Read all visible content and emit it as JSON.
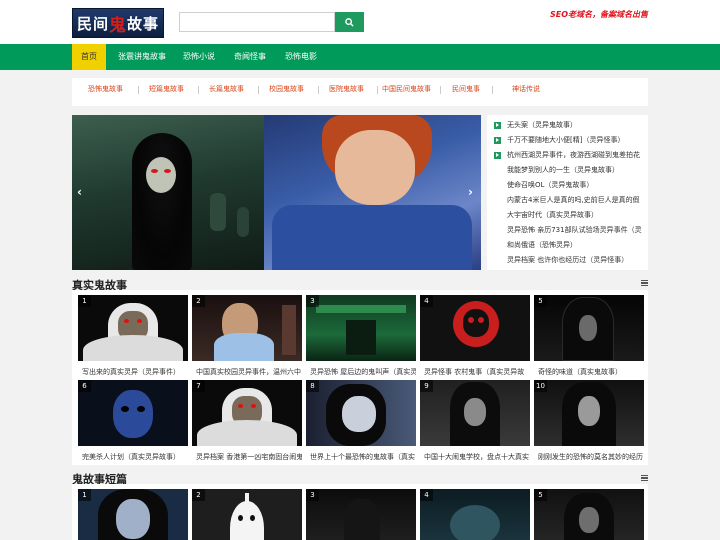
{
  "header": {
    "logo_text_1": "民间",
    "logo_text_2": "鬼",
    "logo_text_3": "故事",
    "search_placeholder": "",
    "slogan": "SEO老域名，备案域名出售"
  },
  "nav": {
    "items": [
      {
        "label": "首页",
        "active": true
      },
      {
        "label": "张震讲鬼故事"
      },
      {
        "label": "恐怖小说"
      },
      {
        "label": "奇闻怪事"
      },
      {
        "label": "恐怖电影"
      }
    ]
  },
  "categories": [
    "恐怖鬼故事",
    "短篇鬼故事",
    "长篇鬼故事",
    "校园鬼故事",
    "医院鬼故事",
    "中国民间鬼故事",
    "民间鬼事",
    "神话传说"
  ],
  "slider": {
    "prev": "‹",
    "next": "›"
  },
  "side_list": [
    "无头案（灵异鬼故事）",
    "千万不要随地大小便[精]（灵异怪事）",
    "杭州西湖灵异事件，夜游西湖碰到鬼差拍花",
    "我能梦到别人的一生（灵异鬼故事）",
    "使命召唤OL（灵异鬼故事）",
    "内蒙古4米巨人是真的吗,史前巨人是真的假",
    "大宇宙时代（真实灵异故事）",
    "灵异恐怖 亲历731部队试验场灵异事件（灵",
    "和尚俄语（恐怖灵异）",
    "灵异档案 也许你也经历过（灵异怪事）"
  ],
  "section1": {
    "title": "真实鬼故事",
    "cards": [
      {
        "num": "1",
        "title": "写出来的真实灵异（灵异事件）"
      },
      {
        "num": "2",
        "title": "中国真实校园灵异事件，温州六中"
      },
      {
        "num": "3",
        "title": "灵异恐怖 屋后边的鬼叫声（真实灵"
      },
      {
        "num": "4",
        "title": "灵异怪事 农村鬼事（真实灵异故"
      },
      {
        "num": "5",
        "title": "奇怪的味道（真实鬼故事）"
      },
      {
        "num": "6",
        "title": "完美杀人计划（真实灵异故事）"
      },
      {
        "num": "7",
        "title": "灵异档案 香港第一凶宅南固台闹鬼"
      },
      {
        "num": "8",
        "title": "世界上十个最恐怖的鬼故事（真实"
      },
      {
        "num": "9",
        "title": "中国十大闹鬼学校，盘点十大真实"
      },
      {
        "num": "10",
        "title": "刚刚发生的恐怖的莫名其妙的经历"
      }
    ]
  },
  "section2": {
    "title": "鬼故事短篇",
    "cards": [
      {
        "num": "1"
      },
      {
        "num": "2"
      },
      {
        "num": "3"
      },
      {
        "num": "4"
      },
      {
        "num": "5"
      }
    ]
  }
}
